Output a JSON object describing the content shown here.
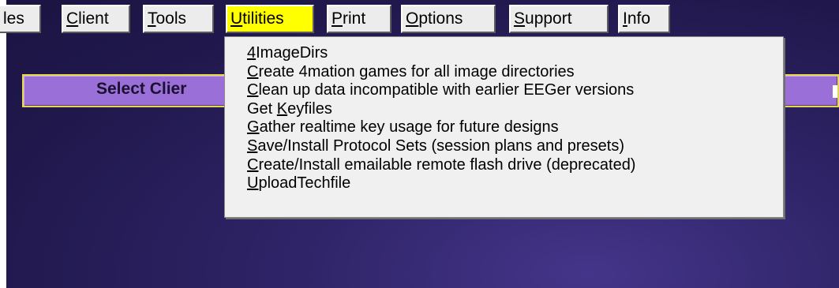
{
  "menubar": {
    "items": [
      {
        "hot": "",
        "rest": "les"
      },
      {
        "hot": "C",
        "rest": "lient"
      },
      {
        "hot": "T",
        "rest": "ools"
      },
      {
        "hot": "U",
        "rest": "tilities"
      },
      {
        "hot": "P",
        "rest": "rint"
      },
      {
        "hot": "O",
        "rest": "ptions"
      },
      {
        "hot": "S",
        "rest": "upport"
      },
      {
        "hot": "I",
        "rest": "nfo"
      }
    ]
  },
  "select_client": {
    "label": "Select Clier"
  },
  "utilities_menu": {
    "items": [
      {
        "pre": "",
        "hot": "4",
        "post": "ImageDirs"
      },
      {
        "pre": "",
        "hot": "C",
        "post": "reate 4mation games for all image directories"
      },
      {
        "pre": "",
        "hot": "C",
        "post": "lean up data incompatible with earlier EEGer versions"
      },
      {
        "pre": "Get ",
        "hot": "K",
        "post": "eyfiles"
      },
      {
        "pre": "",
        "hot": "G",
        "post": "ather realtime key usage for future designs"
      },
      {
        "pre": "",
        "hot": "S",
        "post": "ave/Install Protocol Sets (session plans and presets)"
      },
      {
        "pre": "",
        "hot": "C",
        "post": "reate/Install emailable remote flash drive (deprecated)"
      },
      {
        "pre": "",
        "hot": "U",
        "post": "ploadTechfile"
      }
    ]
  },
  "colors": {
    "active_menu": "#ffff00",
    "select_bar": "#9b6fd8",
    "select_border": "#e6d84a",
    "background": "#2a2160"
  }
}
